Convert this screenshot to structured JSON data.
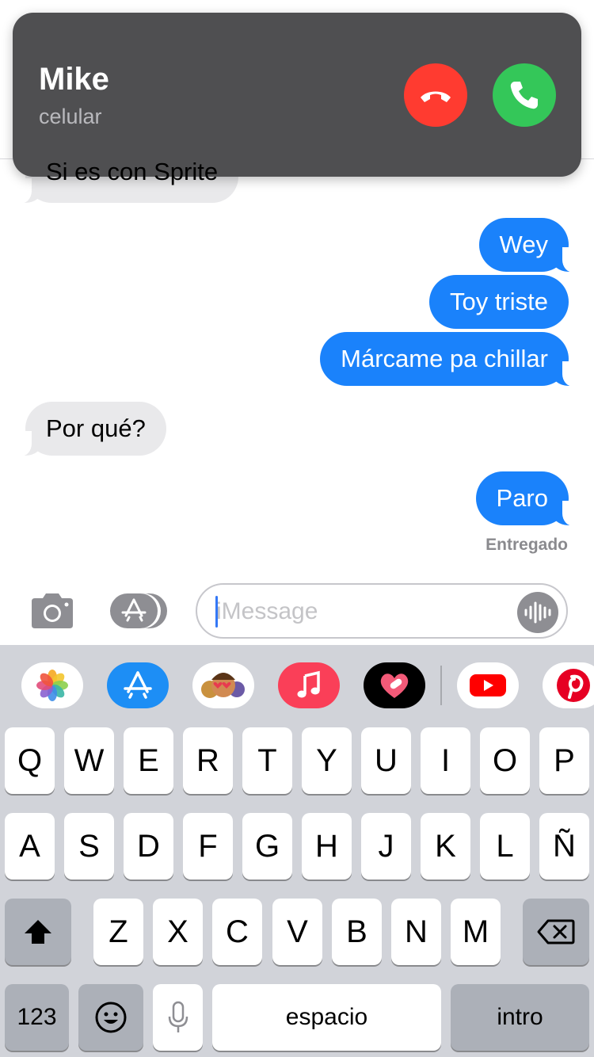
{
  "call": {
    "caller_name": "Mike",
    "caller_label": "celular",
    "decline_icon": "phone-decline-icon",
    "accept_icon": "phone-accept-icon",
    "decline_color": "#ff3b30",
    "accept_color": "#34c759"
  },
  "messages": [
    {
      "direction": "in",
      "text": "Si es con Sprite"
    },
    {
      "direction": "out",
      "text": "Wey"
    },
    {
      "direction": "out",
      "text": "Toy triste"
    },
    {
      "direction": "out",
      "text": "Márcame pa chillar"
    },
    {
      "direction": "in",
      "text": "Por qué?"
    },
    {
      "direction": "out",
      "text": "Paro"
    }
  ],
  "delivery_status": "Entregado",
  "composer": {
    "placeholder": "iMessage",
    "value": "",
    "camera_icon": "camera-icon",
    "apps_icon": "app-store-icon",
    "audio_icon": "audio-waveform-icon"
  },
  "app_strip": [
    {
      "name": "photos-app-icon"
    },
    {
      "name": "app-store-app-icon"
    },
    {
      "name": "memoji-app-icon"
    },
    {
      "name": "music-app-icon"
    },
    {
      "name": "heart-app-icon"
    },
    {
      "name": "youtube-app-icon"
    },
    {
      "name": "pinterest-app-icon"
    }
  ],
  "keyboard": {
    "row1": [
      "Q",
      "W",
      "E",
      "R",
      "T",
      "Y",
      "U",
      "I",
      "O",
      "P"
    ],
    "row2": [
      "A",
      "S",
      "D",
      "F",
      "G",
      "H",
      "J",
      "K",
      "L",
      "Ñ"
    ],
    "row3": [
      "Z",
      "X",
      "C",
      "V",
      "B",
      "N",
      "M"
    ],
    "numbers_label": "123",
    "space_label": "espacio",
    "return_label": "intro",
    "shift_icon": "shift-icon",
    "delete_icon": "delete-icon",
    "emoji_icon": "emoji-icon",
    "dictation_icon": "microphone-icon"
  },
  "colors": {
    "outgoing_bubble": "#1a82fb",
    "incoming_bubble": "#e9e9eb",
    "keyboard_bg": "#d1d3d9"
  }
}
